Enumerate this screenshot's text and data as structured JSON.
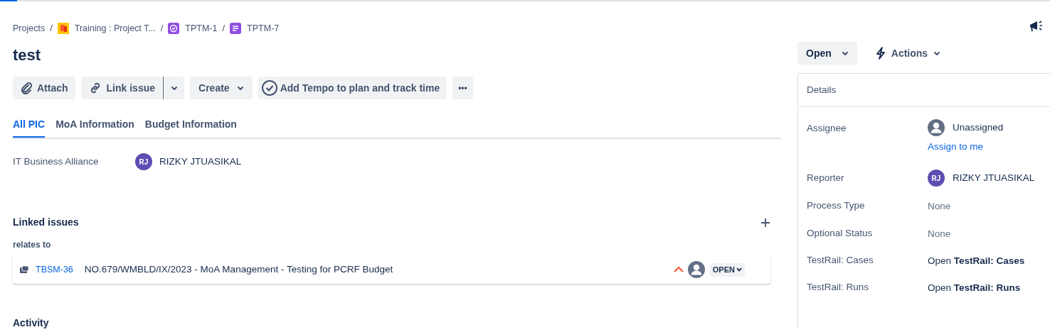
{
  "loading_bar": {
    "level": 0.016
  },
  "breadcrumbs": [
    {
      "label": "Projects",
      "kind": "text",
      "separator": "/"
    },
    {
      "label": "Training : Project T...",
      "kind": "project",
      "separator": "/"
    },
    {
      "label": "TPTM-1",
      "kind": "epic",
      "separator": "/"
    },
    {
      "label": "TPTM-7",
      "kind": "story"
    }
  ],
  "title": "test",
  "toolbar": [
    {
      "label": "Attach",
      "kind": "attach"
    },
    {
      "label": "Link issue",
      "kind": "split"
    },
    {
      "label": "Create",
      "kind": "dropdown"
    },
    {
      "label": "Add Tempo to plan and track time",
      "kind": "tempo"
    },
    {
      "label": "•••",
      "kind": "more"
    }
  ],
  "tabs": [
    {
      "label": "All PIC",
      "selected": true
    },
    {
      "label": "MoA Information",
      "selected": false
    },
    {
      "label": "Budget Information",
      "selected": false
    }
  ],
  "fields": [
    {
      "label": "IT Business Alliance",
      "initials": "RJ",
      "value": "RIZKY JTUASIKAL"
    }
  ],
  "linked_issues": {
    "title": "Linked issues",
    "relation": "relates to",
    "issues": [
      {
        "key": "TBSM-36",
        "summary": "NO.679/WMBLD/IX/2023 - MoA Management - Testing for PCRF Budget",
        "status": "OPEN"
      }
    ]
  },
  "activity": "Activity",
  "status_button": "Open",
  "actions_button": "Actions",
  "details": {
    "title": "Details",
    "rows": [
      {
        "label": "Assignee",
        "kind": "unassigned",
        "value": "Unassigned",
        "link": "Assign to me"
      },
      {
        "label": "Reporter",
        "kind": "user",
        "initials": "RJ",
        "value": "RIZKY JTUASIKAL"
      },
      {
        "label": "Process Type",
        "kind": "none",
        "value": "None"
      },
      {
        "label": "Optional Status",
        "kind": "none",
        "value": "None"
      },
      {
        "label": "TestRail: Cases",
        "kind": "rich",
        "value": "Open **TestRail: Cases**"
      },
      {
        "label": "TestRail: Runs",
        "kind": "rich",
        "value": "Open **TestRail: Runs**"
      }
    ]
  }
}
